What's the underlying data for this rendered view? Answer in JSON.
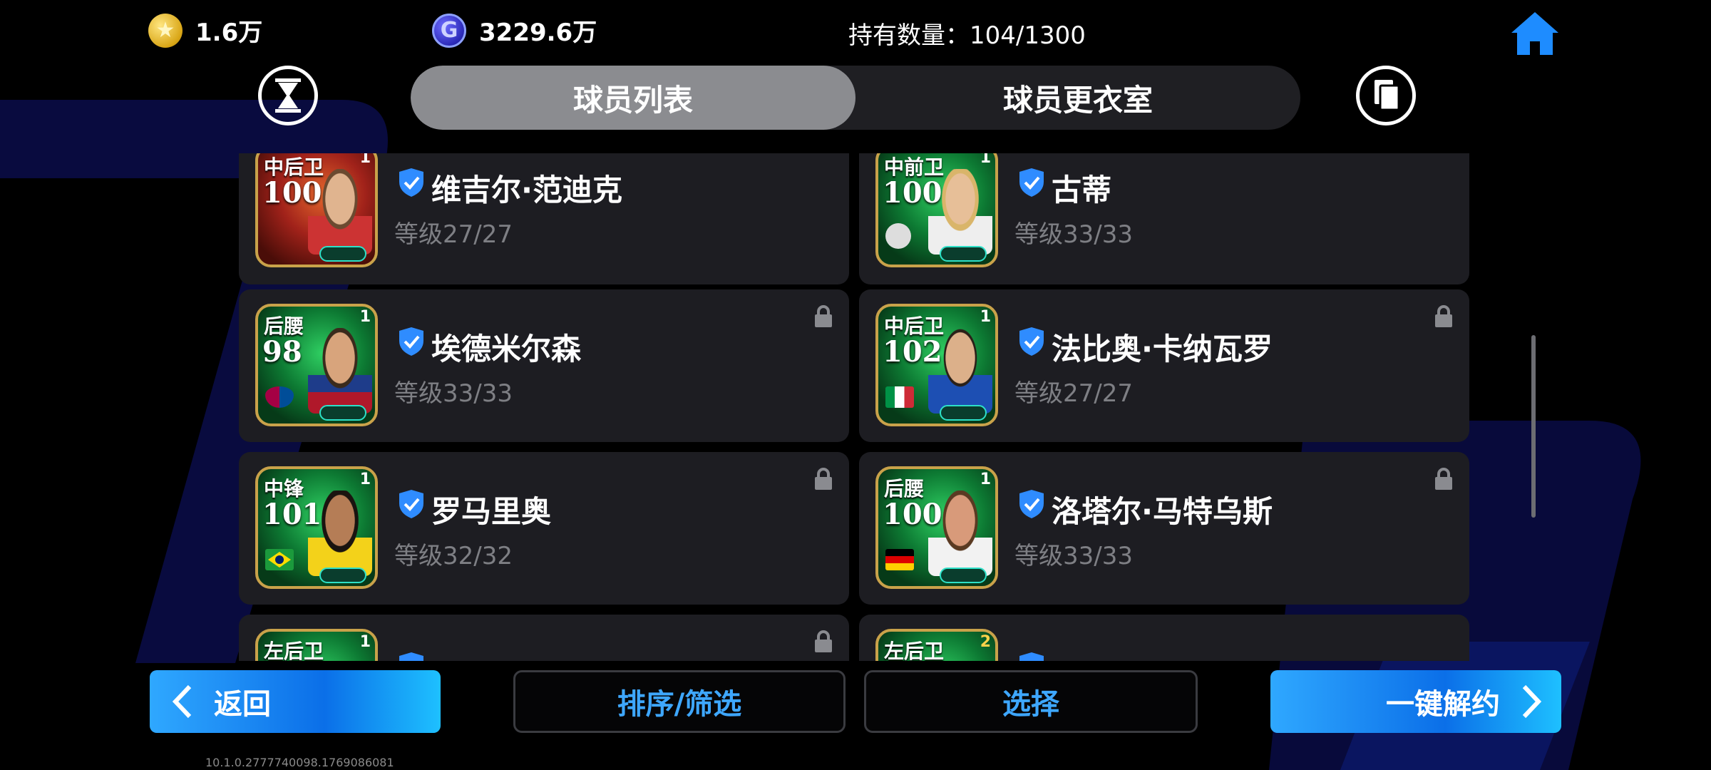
{
  "topbar": {
    "coins": {
      "icon": "gold-coin-icon",
      "value": "1.6万",
      "symbol": "★"
    },
    "gp": {
      "icon": "gp-coin-icon",
      "value": "3229.6万",
      "symbol": "G"
    },
    "holding": "持有数量：104/1300",
    "home_icon": "home-icon"
  },
  "tabs": [
    {
      "label": "球员列表",
      "active": true
    },
    {
      "label": "球员更衣室",
      "active": false
    }
  ],
  "players": [
    {
      "position": "中后卫",
      "rating": "100",
      "card_level": "1",
      "name": "维吉尔·范迪克",
      "level": "等级27/27",
      "locked": false,
      "badge": "club-crest"
    },
    {
      "position": "中前卫",
      "rating": "100",
      "card_level": "1",
      "name": "古蒂",
      "level": "等级33/33",
      "locked": false,
      "badge": "club-crest"
    },
    {
      "position": "后腰",
      "rating": "98",
      "card_level": "1",
      "name": "埃德米尔森",
      "level": "等级33/33",
      "locked": true,
      "badge": "barcelona-crest"
    },
    {
      "position": "中后卫",
      "rating": "102",
      "card_level": "1",
      "name": "法比奥·卡纳瓦罗",
      "level": "等级27/27",
      "locked": true,
      "badge": "italy-flag"
    },
    {
      "position": "中锋",
      "rating": "101",
      "card_level": "1",
      "name": "罗马里奥",
      "level": "等级32/32",
      "locked": true,
      "badge": "brazil-flag"
    },
    {
      "position": "后腰",
      "rating": "100",
      "card_level": "1",
      "name": "洛塔尔·马特乌斯",
      "level": "等级33/33",
      "locked": true,
      "badge": "germany-flag"
    },
    {
      "position": "左后卫",
      "rating": "",
      "card_level": "1",
      "name": "",
      "level": "",
      "locked": true,
      "badge": ""
    },
    {
      "position": "左后卫",
      "rating": "",
      "card_level": "2",
      "name": "",
      "level": "",
      "locked": false,
      "badge": ""
    }
  ],
  "bottombar": {
    "back_label": "返回",
    "sort_label": "排序/筛选",
    "select_label": "选择",
    "unlock_label": "一键解约"
  },
  "version": "10.1.0.2777740098.1769086081",
  "colors": {
    "accent": "#3ea7ff",
    "button_blue": "#0b6fe8",
    "card_bg": "#1d1d22",
    "tab_active": "#8b8c90"
  }
}
